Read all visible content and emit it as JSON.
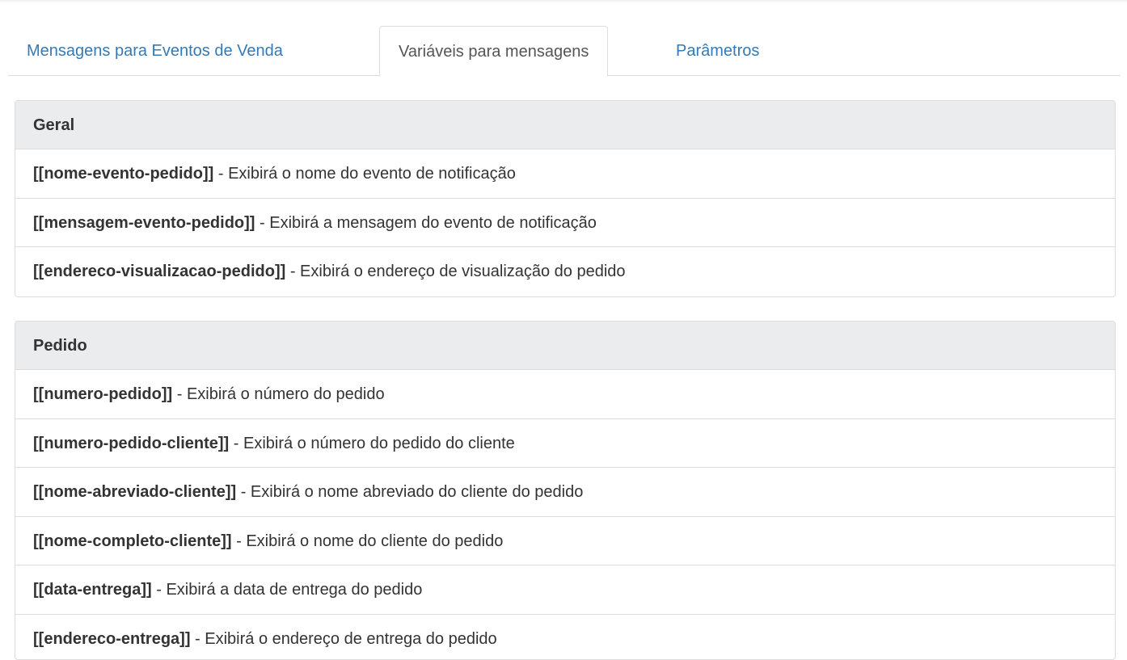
{
  "tabs": [
    {
      "label": "Mensagens para Eventos de Venda"
    },
    {
      "label": "Variáveis para mensagens",
      "active": true
    },
    {
      "label": "Parâmetros"
    }
  ],
  "panels": [
    {
      "title": "Geral",
      "rows": [
        {
          "variable": "[[nome-evento-pedido]]",
          "description": " - Exibirá o nome do evento de notificação"
        },
        {
          "variable": "[[mensagem-evento-pedido]]",
          "description": " - Exibirá a mensagem do evento de notificação"
        },
        {
          "variable": "[[endereco-visualizacao-pedido]]",
          "description": " - Exibirá o endereço de visualização do pedido"
        }
      ]
    },
    {
      "title": "Pedido",
      "rows": [
        {
          "variable": "[[numero-pedido]]",
          "description": " - Exibirá o número do pedido"
        },
        {
          "variable": "[[numero-pedido-cliente]]",
          "description": " - Exibirá o número do pedido do cliente"
        },
        {
          "variable": "[[nome-abreviado-cliente]]",
          "description": " - Exibirá o nome abreviado do cliente do pedido"
        },
        {
          "variable": "[[nome-completo-cliente]]",
          "description": " - Exibirá o nome do cliente do pedido"
        },
        {
          "variable": "[[data-entrega]]",
          "description": " - Exibirá a data de entrega do pedido"
        },
        {
          "variable": "[[endereco-entrega]]",
          "description": " - Exibirá o endereço de entrega do pedido"
        }
      ]
    }
  ]
}
